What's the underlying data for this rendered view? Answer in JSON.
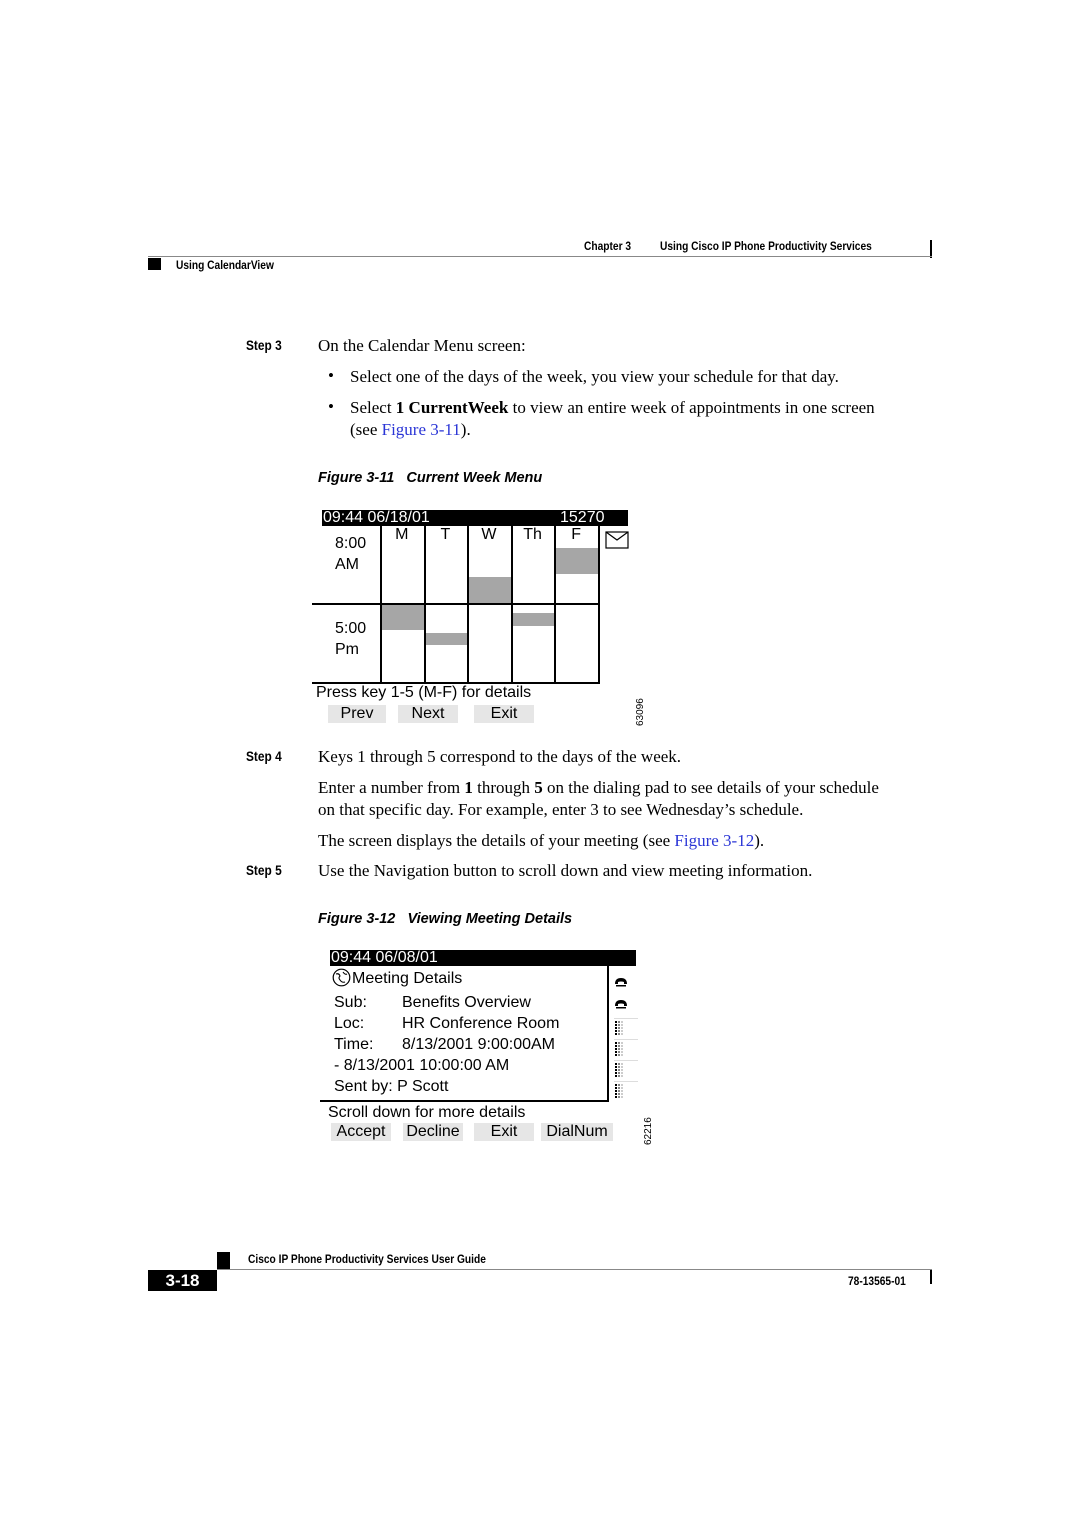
{
  "header": {
    "chapter": "Chapter 3",
    "chapter_title": "Using Cisco IP Phone Productivity Services",
    "section": "Using CalendarView"
  },
  "steps": {
    "step3": {
      "label": "Step 3",
      "text": "On the Calendar Menu screen:",
      "bullets": [
        {
          "text": "Select one of the days of the week, you view your schedule for that day."
        },
        {
          "pre": "Select ",
          "bold": "1 CurrentWeek",
          "post": " to view an entire week of appointments in one screen",
          "line2_pre": "(see ",
          "link": "Figure 3-11",
          "line2_post": ")."
        }
      ]
    },
    "step4": {
      "label": "Step 4",
      "text": "Keys 1 through 5 correspond to the days of the week.",
      "para1_pre": "Enter a number from ",
      "para1_b1": "1",
      "para1_mid": " through ",
      "para1_b2": "5",
      "para1_post": " on the dialing pad to see details of your schedule",
      "para1_line2": "on that specific day. For example, enter 3 to see Wednesday’s schedule.",
      "para2_pre": "The screen displays the details of your meeting (see ",
      "para2_link": "Figure 3-12",
      "para2_post": ")."
    },
    "step5": {
      "label": "Step 5",
      "text": "Use the Navigation button to scroll down and view meeting information."
    }
  },
  "figure11": {
    "caption_num": "Figure 3-11",
    "caption_title": "Current Week Menu",
    "status_time": "09:44 06/18/01",
    "status_ext": "15270",
    "days": [
      "M",
      "T",
      "W",
      "Th",
      "F"
    ],
    "am_time": "8:00",
    "am_label": "AM",
    "pm_time": "5:00",
    "pm_label": "Pm",
    "message_icon": "envelope-icon",
    "prompt": "Press key 1-5 (M-F) for details",
    "softkeys": [
      "Prev",
      "Next",
      "Exit"
    ],
    "figure_id": "63096",
    "appointments": [
      {
        "day": "W",
        "block": "am",
        "start": 0.66,
        "end": 1.0
      },
      {
        "day": "F",
        "block": "am",
        "start": 0.28,
        "end": 0.62
      },
      {
        "day": "M",
        "block": "pm",
        "start": 0.0,
        "end": 0.33
      },
      {
        "day": "T",
        "block": "pm",
        "start": 0.36,
        "end": 0.52
      },
      {
        "day": "Th",
        "block": "pm",
        "start": 0.11,
        "end": 0.27
      }
    ],
    "appointment_color": "#a6a6a6"
  },
  "figure12": {
    "caption_num": "Figure 3-12",
    "caption_title": "Viewing Meeting Details",
    "status_time": "09:44 06/08/01",
    "title_icon": "globe-icon",
    "title": "Meeting Details",
    "rows": [
      {
        "label": "Sub:",
        "value": "Benefits Overview"
      },
      {
        "label": "Loc:",
        "value": "HR Conference Room"
      },
      {
        "label": "Time:",
        "value": "8/13/2001 9:00:00AM"
      }
    ],
    "time_end": "- 8/13/2001 10:00:00 AM",
    "sent_by": "Sent by: P Scott",
    "line_icons": [
      "phone-handset-icon",
      "phone-handset-icon",
      "line-dots-icon",
      "line-dots-icon",
      "line-dots-icon",
      "line-dots-icon"
    ],
    "prompt": "Scroll down for more details",
    "softkeys": [
      "Accept",
      "Decline",
      "Exit",
      "DialNum"
    ],
    "figure_id": "62216"
  },
  "footer": {
    "guide_title": "Cisco IP Phone Productivity Services User Guide",
    "page_number": "3-18",
    "doc_number": "78-13565-01"
  }
}
